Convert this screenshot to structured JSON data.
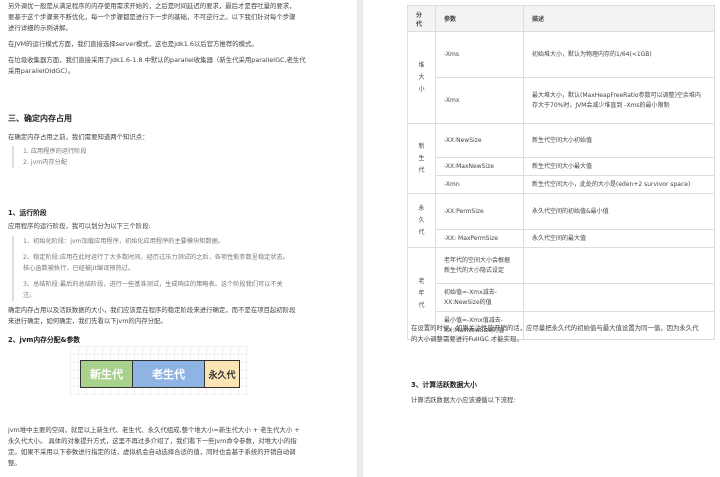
{
  "left": {
    "intro_lines": [
      "另外调优一般是从满足程序的内存使用需求开始的，之后是时间延迟的要求，最后才是吞吐量的要求，",
      "要基于这个步骤来不断优化，每一个步骤都是进行下一步的基础，不可逆行之。以下我们针对每个步骤",
      "进行详细的示例讲解。"
    ],
    "jvm_mode": "在JVM的运行模式方面，我们直接选择server模式，这也是jdk1.6以后官方推荐的模式。",
    "gc_lines": [
      "在垃圾收集器方面，我们直接采用了jdk1.6-1.8 中默认的parallel收集器（新生代采用parallelGC,老生代",
      "采用parallelOldGC）。"
    ],
    "section3_title": "三、确定内存占用",
    "section3_intro": "在确定内存占用之前，我们需要知道两个知识点：",
    "section3_points": [
      "1. 应用程序的运行阶段",
      "2. jvm内存分配"
    ],
    "run_stage_title": "1、运行阶段",
    "run_stage_intro": "应用程序的运行阶段，我可以划分为以下三个阶段:",
    "run_stage_items": [
      "1、初始化阶段：jvm加载应用程序，初始化应用程序的主要模块和数据。",
      "2、稳定阶段:应用在此时运行了大多数时间，经历过压力测试的之后，各项性能参数呈稳定状态。",
      "核心函数被执行，已经被jit编译预热过。",
      "3、总结阶段:最后的总结阶段，进行一些基准测试，生成响应的策略表。这个阶段我们可以不关",
      "注。"
    ],
    "run_stage_note": [
      "确定内存占用以及活跃数据的大小，我们应该是在程序的稳定阶段来进行确定，而不是在项目起初阶段",
      "来进行确定，如何确定，我们先看以下jvm的内存分配。"
    ],
    "alloc_title": "2、jvm内存分配&参数",
    "diagram": {
      "young": "新生代",
      "old": "老生代",
      "perm": "永久代"
    },
    "alloc_text": [
      "jvm堆中主要的空间，就是以上新生代、老生代、永久代组成,整个堆大小=新生代大小 + 老生代大小 +",
      "永久代大小。 具体的对象提升方式，这里不再过多介绍了，我们看下一些jvm命令参数，对堆大小的指",
      "定。如果不采用以下参数进行指定的话，虚拟机会自动选择合适的值，同时也会基于系统的开销自动调",
      "整。"
    ]
  },
  "table": {
    "headers": [
      "分代",
      "参数",
      "描述"
    ],
    "rows": [
      {
        "cat": [
          "堆",
          "大",
          "小"
        ],
        "span": 2,
        "param": "-Xms",
        "desc": "初始堆大小，默认为物理内存的1/64(<1GB)"
      },
      {
        "param": "-Xmx",
        "desc": "最大堆大小，默认(MaxHeapFreeRatio参数可以调整)空余堆内存大于70%时，JVM会减少堆直到 -Xms的最小限制"
      },
      {
        "cat": [
          "新",
          "生",
          "代"
        ],
        "span": 3,
        "param": "-XX:NewSize",
        "desc": "新生代空间大小初始值"
      },
      {
        "param": "-XX:MaxNewSize",
        "desc": "新生代空间大小最大值"
      },
      {
        "param": "-Xmn",
        "desc": "新生代空间大小，此处的大小是(eden+2 survivor space)"
      },
      {
        "cat": [
          "永",
          "久",
          "代"
        ],
        "span": 2,
        "param": "-XX:PermSize",
        "desc": "永久代空间的初始值&最小值"
      },
      {
        "param": "-XX:  MaxPermSize",
        "desc": "永久代空间的最大值"
      },
      {
        "cat": [
          "老",
          "年",
          "代"
        ],
        "span": 3,
        "param": "老年代的空间大小会根据新生代的大小隐式设定",
        "desc": ""
      },
      {
        "param": "初始值=-Xmx减去-XX:NewSize的值",
        "desc": ""
      },
      {
        "param": "最小值=-Xmx值减去-XX:MaxNewSize的值",
        "desc": ""
      }
    ]
  },
  "right": {
    "note": [
      "在设置的时候，如果关注性能开销的话，应尽量把永久代的初始值与最大值设置为同一值，因为永久代",
      "的大小调整需要进行FullGC 才能实现。"
    ],
    "section3_title": "3、计算活跃数据大小",
    "section3_text": "计算活跃数据大小应该遵循以下流程:"
  }
}
